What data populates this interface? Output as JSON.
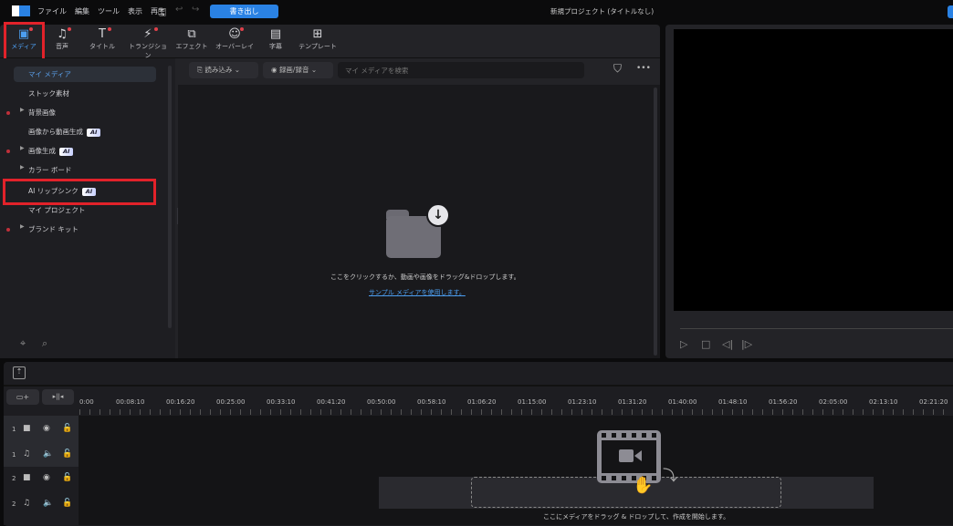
{
  "menubar": {
    "items": [
      "ファイル",
      "編集",
      "ツール",
      "表示",
      "再生"
    ],
    "export_label": "書き出し",
    "project_title": "新規プロジェクト (タイトルなし)"
  },
  "tabs": [
    {
      "label": "メディア",
      "icon": "media-icon"
    },
    {
      "label": "音声",
      "icon": "music-icon"
    },
    {
      "label": "タイトル",
      "icon": "title-icon"
    },
    {
      "label": "トランジション",
      "icon": "transition-icon"
    },
    {
      "label": "エフェクト",
      "icon": "effect-icon"
    },
    {
      "label": "オーバーレイ",
      "icon": "sticker-icon"
    },
    {
      "label": "字幕",
      "icon": "caption-icon"
    },
    {
      "label": "テンプレート",
      "icon": "template-icon"
    }
  ],
  "sidebar": {
    "items": [
      {
        "label": "マイ メディア"
      },
      {
        "label": "ストック素材"
      },
      {
        "label": "背景画像"
      },
      {
        "label": "画像から動画生成",
        "badge": "AI"
      },
      {
        "label": "画像生成",
        "badge": "AI"
      },
      {
        "label": "カラー ボード"
      },
      {
        "label": "AI リップシンク",
        "badge": "AI"
      },
      {
        "label": "マイ プロジェクト"
      },
      {
        "label": "ブランド キット"
      }
    ]
  },
  "media": {
    "import_label": "読み込み",
    "record_label": "録画/録音",
    "search_placeholder": "マイ メディアを検索",
    "empty_text": "ここをクリックするか、動画や画像をドラッグ&ドロップします。",
    "sample_link": "サンプル メディアを使用します。"
  },
  "timeline": {
    "ruler": [
      "0:00",
      "00:08:10",
      "00:16:20",
      "00:25:00",
      "00:33:10",
      "00:41:20",
      "00:50:00",
      "00:58:10",
      "01:06:20",
      "01:15:00",
      "01:23:10",
      "01:31:20",
      "01:40:00",
      "01:48:10",
      "01:56:20",
      "02:05:00",
      "02:13:10",
      "02:21:20"
    ],
    "tracks": [
      "1",
      "1",
      "2",
      "2"
    ],
    "drop_text": "ここにメディアをドラッグ & ドロップして、作成を開始します。"
  },
  "colors": {
    "accent": "#2a82e4",
    "highlight": "#e2222a"
  }
}
